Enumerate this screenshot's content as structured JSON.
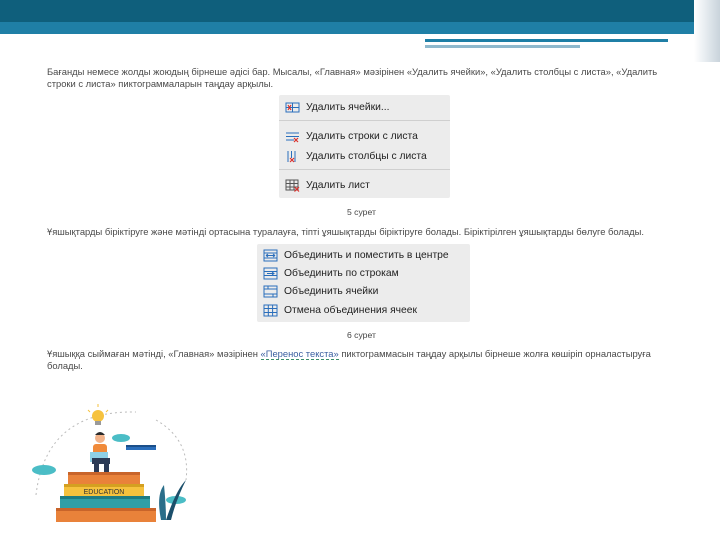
{
  "paragraphs": {
    "p1": "Бағанды немесе жолды жоюдың бірнеше әдісі бар. Мысалы, «Главная» мәзірінен «Удалить ячейки», «Удалить столбцы с листа», «Удалить строки с листа» пиктограммаларын таңдау арқылы.",
    "p2": "Ұяшықтарды біріктіруге және мәтінді ортасына туралауға, тіпті ұяшықтарды біріктіруге болады. Біріктірілген ұяшықтарды бөлуге болады.",
    "p3_before": "Ұяшыққа сыймаған мәтінді, «Главная» мәзірінен ",
    "p3_link": "«Перенос текста»",
    "p3_after": " пиктограммасын таңдау арқылы бірнеше жолға көшіріп орналастыруға болады."
  },
  "menu_delete": {
    "items": [
      {
        "label": "Удалить ячейки...",
        "icon": "delete-cells-icon"
      },
      {
        "label": "Удалить строки с листа",
        "icon": "delete-rows-icon"
      },
      {
        "label": "Удалить столбцы с листа",
        "icon": "delete-columns-icon"
      },
      {
        "label": "Удалить лист",
        "icon": "delete-sheet-icon"
      }
    ]
  },
  "caption_1": "5 сурет",
  "menu_merge": {
    "items": [
      {
        "label": "Объединить и поместить в центре",
        "icon": "merge-center-icon"
      },
      {
        "label": "Объединить по строкам",
        "icon": "merge-across-icon"
      },
      {
        "label": "Объединить ячейки",
        "icon": "merge-cells-icon"
      },
      {
        "label": "Отмена объединения ячеек",
        "icon": "unmerge-cells-icon"
      }
    ]
  },
  "caption_2": "6 сурет",
  "illustration": {
    "book_label": "EDUCATION"
  },
  "colors": {
    "header_dark": "#0f5f7c",
    "header_light": "#1f7fa6",
    "icon_blue": "#2a6ebb",
    "icon_red": "#d9302c"
  }
}
